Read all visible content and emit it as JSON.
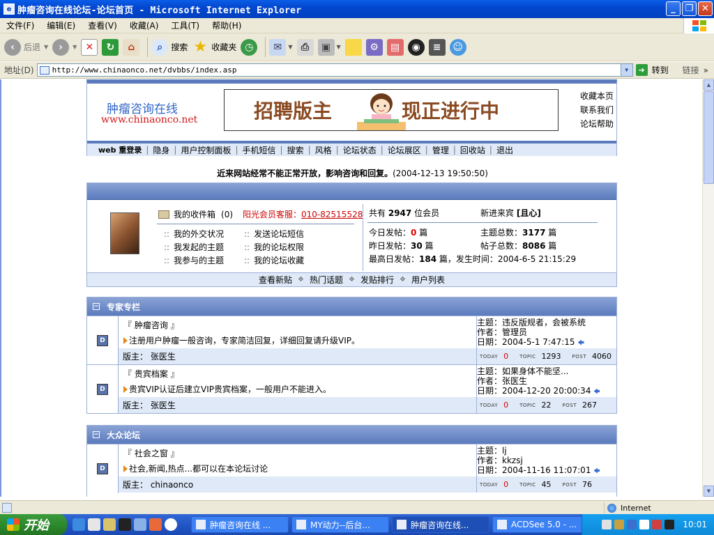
{
  "window": {
    "title": "肿瘤咨询在线论坛-论坛首页 - Microsoft Internet Explorer"
  },
  "menu": [
    "文件(F)",
    "编辑(E)",
    "查看(V)",
    "收藏(A)",
    "工具(T)",
    "帮助(H)"
  ],
  "toolbar": {
    "back": "后退",
    "search": "搜索",
    "favorites": "收藏夹"
  },
  "address": {
    "label": "地址(D)",
    "url": "http://www.chinaonco.net/dvbbs/index.asp",
    "go": "转到",
    "links": "链接"
  },
  "site": {
    "logo_cn": "肿瘤咨询在线",
    "logo_url": "www.chinaonco.net",
    "banner_left": "招聘版主",
    "banner_right": "现正进行中",
    "header_links": [
      "收藏本页",
      "联系我们",
      "论坛帮助"
    ],
    "nav": [
      "web 重登录",
      "隐身",
      "用户控制面板",
      "手机短信",
      "搜索",
      "风格",
      "论坛状态",
      "论坛展区",
      "管理",
      "回收站",
      "退出"
    ]
  },
  "notice": {
    "text": "近来网站经常不能正常开放，影响咨询和回复。",
    "time": "(2004-12-13 19:50:50)"
  },
  "user": {
    "inbox_label": "我的收件箱",
    "inbox_count": "(0)",
    "hotline_label": "阳光会员客服：",
    "hotline_number": "010-82515528",
    "links": [
      [
        "我的外交状况",
        "发送论坛短信"
      ],
      [
        "我发起的主题",
        "我的论坛权限"
      ],
      [
        "我参与的主题",
        "我的论坛收藏"
      ]
    ]
  },
  "stats": {
    "members_pre": "共有",
    "members": "2947",
    "members_post": "位会员",
    "newest_label": "新进来宾",
    "newest": "[且心]",
    "today_label": "今日发帖：",
    "today": "0",
    "unit": "篇",
    "topics_label": "主题总数：",
    "topics": "3177",
    "yesterday_label": "昨日发帖：",
    "yesterday": "30",
    "posts_label": "帖子总数：",
    "posts": "8086",
    "max_label": "最高日发帖：",
    "max": "184",
    "max_time": "篇，发生时间：2004-6-5 21:15:29"
  },
  "quicklinks": [
    "查看新贴",
    "热门话题",
    "发贴排行",
    "用户列表"
  ],
  "categories": [
    {
      "title": "专家专栏",
      "forums": [
        {
          "name": "『 肿瘤咨询 』",
          "desc": "注册用户肿瘤一般咨询，专家简洁回复，详细回复请升级VIP。",
          "mod": "版主： 张医生",
          "topic": "主题：违反版规者，会被系统",
          "author": "作者：管理员",
          "date": "日期：2004-5-1 7:47:15",
          "today": "0",
          "topics": "1293",
          "posts": "4060"
        },
        {
          "name": "『 贵宾档案 』",
          "desc": "贵宾VIP认证后建立VIP贵宾档案，一般用户不能进入。",
          "mod": "版主： 张医生",
          "topic": "主题：如果身体不能坚...",
          "author": "作者：张医生",
          "date": "日期：2004-12-20 20:00:34",
          "today": "0",
          "topics": "22",
          "posts": "267"
        }
      ]
    },
    {
      "title": "大众论坛",
      "forums": [
        {
          "name": "『 社会之窗 』",
          "desc": "社会,新闻,热点...都可以在本论坛讨论",
          "mod": "版主： chinaonco",
          "topic": "主题：lj",
          "author": "作者：kkzsj",
          "date": "日期：2004-11-16 11:07:01",
          "today": "0",
          "topics": "45",
          "posts": "76"
        }
      ]
    }
  ],
  "count_labels": {
    "today": "TODAY",
    "topic": "TOPIC",
    "post": "POST"
  },
  "status": {
    "zone": "Internet"
  },
  "taskbar": {
    "start": "开始",
    "tasks": [
      "肿瘤咨询在线 ...",
      "MY动力--后台...",
      "肿瘤咨询在线...",
      "ACDSee 5.0 - ..."
    ],
    "clock": "10:01"
  }
}
